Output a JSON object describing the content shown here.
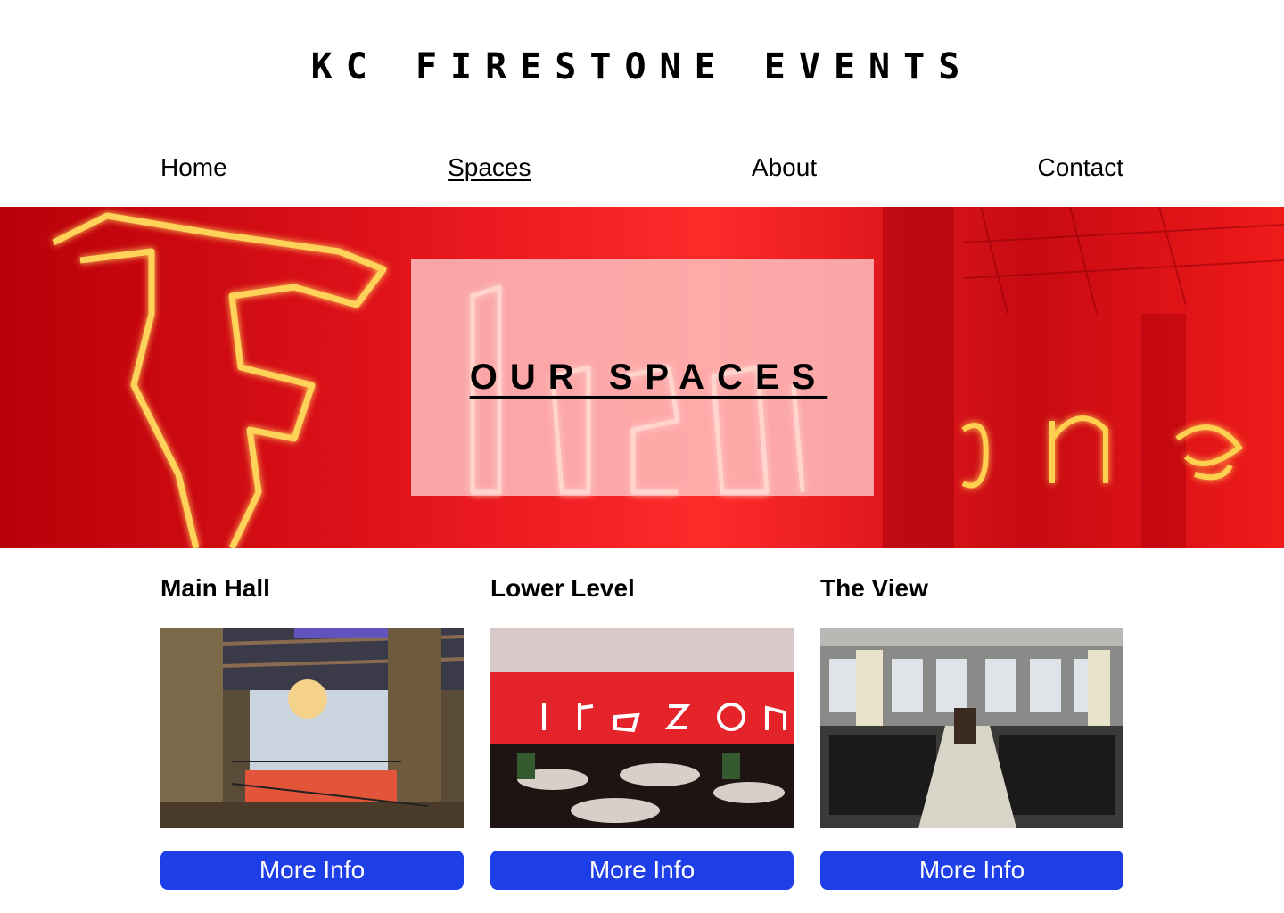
{
  "site": {
    "title": "KC FIRESTONE EVENTS"
  },
  "nav": {
    "items": [
      {
        "label": "Home",
        "active": false
      },
      {
        "label": "Spaces",
        "active": true
      },
      {
        "label": "About",
        "active": false
      },
      {
        "label": "Contact",
        "active": false
      }
    ]
  },
  "hero": {
    "title": "OUR SPACES"
  },
  "spaces": [
    {
      "title": "Main Hall",
      "button_label": "More Info"
    },
    {
      "title": "Lower Level",
      "button_label": "More Info"
    },
    {
      "title": "The View",
      "button_label": "More Info"
    }
  ],
  "colors": {
    "accent": "#1e3ee8",
    "hero_red": "#e0121a",
    "text": "#000000"
  }
}
